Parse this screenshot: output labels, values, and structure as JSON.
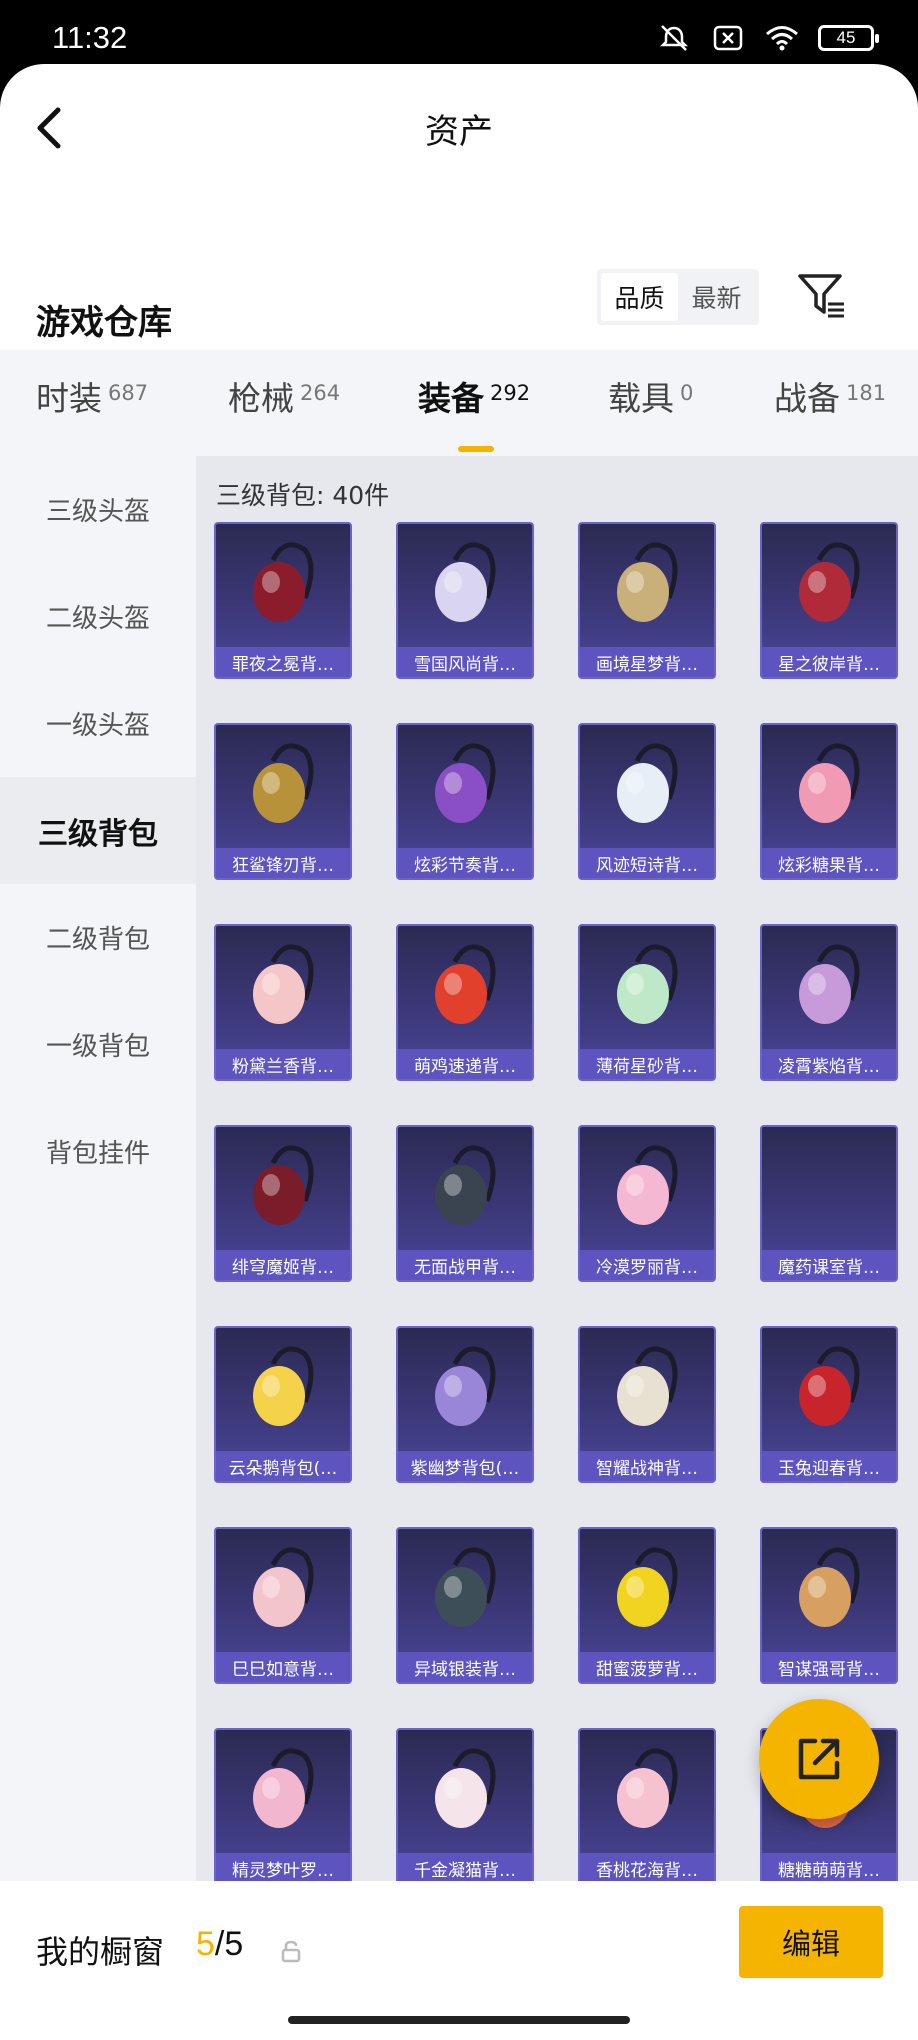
{
  "status": {
    "time": "11:32",
    "battery": "45",
    "icons": [
      "mute-icon",
      "sim-off-icon",
      "wifi-icon",
      "battery-icon"
    ]
  },
  "nav": {
    "title": "资产",
    "back_icon": "chevron-left-icon"
  },
  "warehouse": {
    "title": "游戏仓库",
    "sort_options": [
      "品质",
      "最新"
    ],
    "sort_selected": "品质",
    "filter_icon": "filter-icon"
  },
  "tabs": [
    {
      "label": "时装",
      "count": "687"
    },
    {
      "label": "枪械",
      "count": "264"
    },
    {
      "label": "装备",
      "count": "292",
      "active": true
    },
    {
      "label": "载具",
      "count": "0"
    },
    {
      "label": "战备",
      "count": "181"
    }
  ],
  "sidebar": {
    "items": [
      "三级头盔",
      "二级头盔",
      "一级头盔",
      "三级背包",
      "二级背包",
      "一级背包",
      "背包挂件"
    ],
    "active": "三级背包"
  },
  "content": {
    "group_title": "三级背包: 40件",
    "items": [
      {
        "name": "罪夜之冕背…",
        "color": "#8b1c2c"
      },
      {
        "name": "雪国风尚背…",
        "color": "#d9d4f0"
      },
      {
        "name": "画境星梦背…",
        "color": "#c9b078"
      },
      {
        "name": "星之彼岸背…",
        "color": "#b02a3a"
      },
      {
        "name": "狂鲨锋刃背…",
        "color": "#b8923a"
      },
      {
        "name": "炫彩节奏背…",
        "color": "#8a4fc4"
      },
      {
        "name": "风迹短诗背…",
        "color": "#e7eef6"
      },
      {
        "name": "炫彩糖果背…",
        "color": "#f09ab4"
      },
      {
        "name": "粉黛兰香背…",
        "color": "#f4c6c8"
      },
      {
        "name": "萌鸡速递背…",
        "color": "#e0402c"
      },
      {
        "name": "薄荷星砂背…",
        "color": "#bfe8c8"
      },
      {
        "name": "凌霄紫焰背…",
        "color": "#c79ad9"
      },
      {
        "name": "绯穹魔姬背…",
        "color": "#7a1c2a"
      },
      {
        "name": "无面战甲背…",
        "color": "#3a4450"
      },
      {
        "name": "冷漠罗丽背…",
        "color": "#f5b8d2"
      },
      {
        "name": "魔药课室背…",
        "color": ""
      },
      {
        "name": "云朵鹅背包(…",
        "color": "#f4d24a"
      },
      {
        "name": "紫幽梦背包(…",
        "color": "#9a86d8"
      },
      {
        "name": "智耀战神背…",
        "color": "#e8e0d0"
      },
      {
        "name": "玉兔迎春背…",
        "color": "#c8242c"
      },
      {
        "name": "巳巳如意背…",
        "color": "#f2c4cc"
      },
      {
        "name": "异域银装背…",
        "color": "#3e4e58"
      },
      {
        "name": "甜蜜菠萝背…",
        "color": "#f0d420"
      },
      {
        "name": "智谋强哥背…",
        "color": "#d8a060"
      },
      {
        "name": "精灵梦叶罗…",
        "color": "#f3b6cf"
      },
      {
        "name": "千金凝猫背…",
        "color": "#f5e4ea"
      },
      {
        "name": "香桃花海背…",
        "color": "#f7c2cf"
      },
      {
        "name": "糖糖萌萌背…",
        "color": "#e06a40"
      }
    ]
  },
  "fab": {
    "icon": "share-external-icon"
  },
  "bottom": {
    "showcase_label": "我的橱窗",
    "showcase_current": "5",
    "showcase_total": "/5",
    "lock_icon": "lock-icon",
    "edit_label": "编辑"
  },
  "colors": {
    "accent": "#f5b400",
    "card_bg": "#3c3879",
    "card_label_bg": "#5d54bf"
  }
}
